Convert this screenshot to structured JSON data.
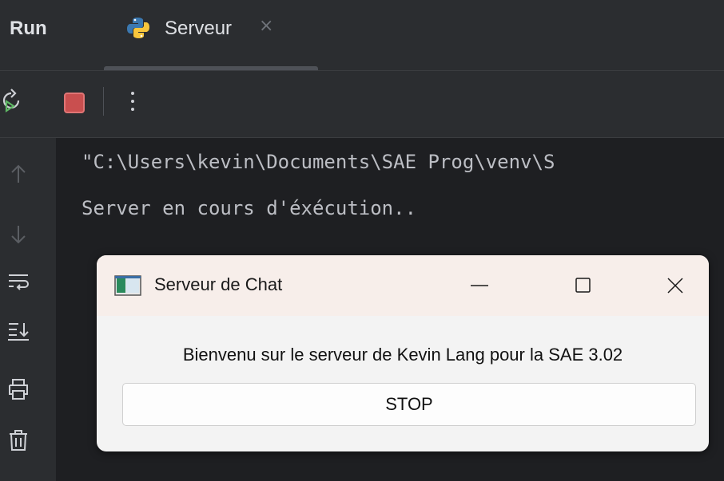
{
  "tabbar": {
    "run_label": "Run",
    "tab": {
      "label": "Serveur",
      "close_glyph": "×",
      "icon": "python-icon"
    }
  },
  "toolbar": {
    "rerun_icon": "rerun-icon",
    "stop_icon": "stop-icon",
    "more_icon": "more-vertical-icon"
  },
  "gutter": {
    "icons": [
      "arrow-up-icon",
      "arrow-down-icon",
      "soft-wrap-icon",
      "scroll-to-end-icon",
      "print-icon",
      "trash-icon"
    ]
  },
  "console": {
    "lines": [
      "\"C:\\Users\\kevin\\Documents\\SAE Prog\\venv\\S",
      "Server en cours d'éxécution.."
    ]
  },
  "dialog": {
    "title": "Serveur de Chat",
    "message": "Bienvenu sur le serveur de Kevin Lang pour la SAE 3.02",
    "button_label": "STOP"
  },
  "colors": {
    "background": "#1e1f22",
    "panel": "#2b2d30",
    "stop_red": "#c94f4f",
    "text": "#bcbec4"
  }
}
